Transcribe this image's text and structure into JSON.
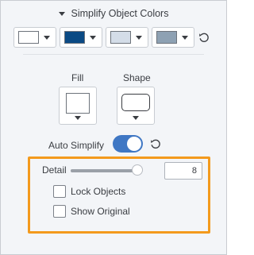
{
  "header": {
    "title": "Simplify Object Colors"
  },
  "swatches": [
    {
      "name": "white",
      "color": "#ffffff"
    },
    {
      "name": "dark-blue",
      "color": "#0b4a84"
    },
    {
      "name": "light-blue-gray",
      "color": "#d4dde8"
    },
    {
      "name": "slate-gray",
      "color": "#8ea1b3"
    }
  ],
  "fill": {
    "label": "Fill"
  },
  "shape": {
    "label": "Shape"
  },
  "auto_simplify": {
    "label": "Auto Simplify",
    "on": true
  },
  "detail": {
    "label": "Detail",
    "value": "8",
    "slider_fraction": 0.95
  },
  "lock_objects": {
    "label": "Lock Objects",
    "checked": false
  },
  "show_original": {
    "label": "Show Original",
    "checked": false
  },
  "colors": {
    "accent": "#3f77c4",
    "highlight_border": "#f39a1d"
  }
}
